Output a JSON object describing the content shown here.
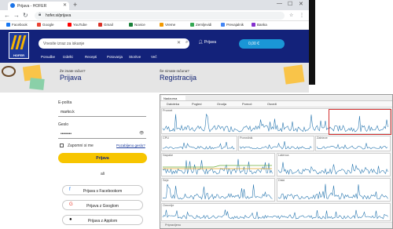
{
  "browser": {
    "tab_title": "Prijava - HOFER",
    "url": "hofer.si/prijava",
    "bookmarks": [
      {
        "label": "Facebook",
        "color": "#1877f2"
      },
      {
        "label": "Google",
        "color": "#ea4335"
      },
      {
        "label": "YouTube",
        "color": "#ff0000"
      },
      {
        "label": "Gmail",
        "color": "#d93025"
      },
      {
        "label": "Novice",
        "color": "#188038"
      },
      {
        "label": "Vreme",
        "color": "#f29900"
      },
      {
        "label": "Zemljevidi",
        "color": "#34a853"
      },
      {
        "label": "Prevajalnik",
        "color": "#4285f4"
      },
      {
        "label": "Banka",
        "color": "#8430ce"
      }
    ]
  },
  "site": {
    "brand": "HOFER",
    "search_placeholder": "Vnesite izraz za iskanje",
    "login_link": "Prijava",
    "cart_label": "0,00 €",
    "categories": [
      "Ponudbe",
      "Izdelki",
      "Recepti",
      "Potovanja",
      "Storitve",
      "Več"
    ],
    "colors": {
      "header": "#13227a",
      "accent": "#f7c500",
      "cart": "#1a96d6"
    }
  },
  "login": {
    "small": "Že imate račun?",
    "title": "Prijava",
    "email_label": "E-pošta",
    "email_value": "marko.k",
    "password_label": "Geslo",
    "password_value": "••••••••",
    "remember_label": "Zapomni si me",
    "forgot_label": "Pozabljeno geslo?",
    "submit_label": "Prijava",
    "or_label": "ali",
    "social": [
      {
        "label": "Prijava s Facebookom",
        "icon": "facebook-icon",
        "glyph": "f",
        "color": "#1877f2"
      },
      {
        "label": "Prijava z Googlom",
        "icon": "google-icon",
        "glyph": "G",
        "color": "#ea4335"
      },
      {
        "label": "Prijava z Applom",
        "icon": "apple-icon",
        "glyph": "●",
        "color": "#000000"
      }
    ]
  },
  "register": {
    "small": "Še nimate računa?",
    "title": "Registracija"
  },
  "monitor": {
    "tab_title": "Nadzorna plošča",
    "toolbar_items": [
      "Datoteka",
      "Pogled",
      "Orodja",
      "Pomoč",
      "Osveži"
    ],
    "panel_titles": [
      "Promet",
      "CPU",
      "Pomnilnik",
      "Zahteve",
      "Napake",
      "Latenca",
      "Seje",
      "Diski",
      "Omrežje"
    ],
    "status_text": "Pripravljeno",
    "line_color": "#2a78b0"
  }
}
